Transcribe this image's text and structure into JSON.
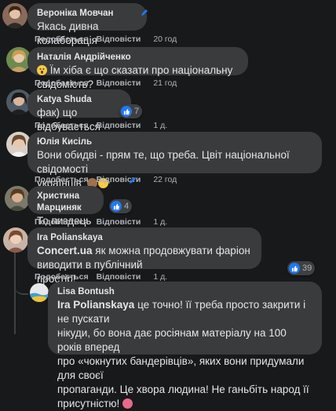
{
  "actions": {
    "like": "Подобається",
    "reply": "Відповісти"
  },
  "comments": [
    {
      "name": "Вероніка Мовчан",
      "text": "Якась дивна колаборація",
      "time": "20 год",
      "edited": true
    },
    {
      "name": "Наталія Андрійченко",
      "text": "Їм хіба є що сказати про національну свідомість?",
      "time": "21 год",
      "emoji": "😮"
    },
    {
      "name": "Katya Shuda",
      "text": "фак) що відбувається",
      "time": "1 д.",
      "reactions": "7"
    },
    {
      "name": "Юлія Кисіль",
      "text_line1": "Вони обидві - прям те, що треба. Цвіт національної свідомості",
      "text_line2": "українців",
      "time": "22 год",
      "edited": true,
      "emoji": "🙈😂"
    },
    {
      "name": "Христина Марциняк",
      "text": "То пиздець",
      "time": "1 д.",
      "emoji": "🙂",
      "reactions": "4"
    },
    {
      "name": "Ira Polianskaya",
      "mention": "Concert.ua",
      "text_line1": " як можна продовжувати фаріон виводити в публічний",
      "text_line2": "простір!",
      "time": "1 д.",
      "reactions": "39"
    }
  ],
  "reply": {
    "name": "Lisa Bontush",
    "mention": "Ira Polianskaya",
    "lines": [
      " це точно! її треба просто закрити і не пускати",
      "нікуди, бо вона дає росіянам матеріалу на 100 років вперед",
      "про «чокнутих бандерівців», яких вони придумали для своєї",
      "пропаганди. Це хвора людина! Не ганьбіть народ її",
      "присутністю!"
    ],
    "emoji": "🙎"
  },
  "colors": {
    "background": "#18191a",
    "bubble": "#3a3b3c",
    "like_blue": "#2078f4"
  }
}
